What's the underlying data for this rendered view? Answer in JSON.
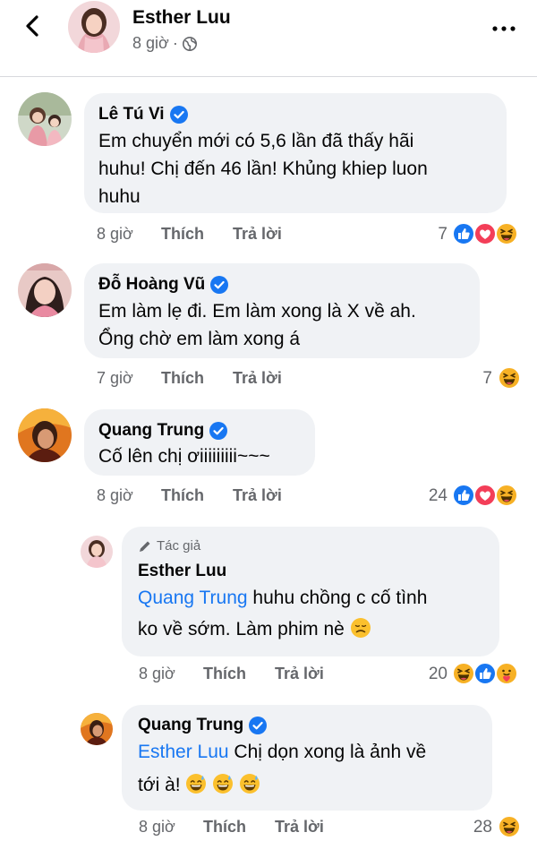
{
  "post": {
    "author": "Esther Luu",
    "time": "8 giờ",
    "privacy_icon": "globe-icon"
  },
  "colors": {
    "bubble": "#f0f2f5",
    "meta_text": "#65676b",
    "link": "#1877f2",
    "verified": "#1877f2",
    "like": "#1877f2",
    "love": "#f33e58",
    "haha": "#f7b125"
  },
  "comments": [
    {
      "name": "Lê Tú Vi",
      "verified": true,
      "lines": [
        "Em chuyển mới có 5,6 lần đã thấy hãi",
        "huhu! Chị đến 46 lần! Khủng khiep luon",
        "huhu"
      ],
      "time": "8 giờ",
      "like_label": "Thích",
      "reply_label": "Trả lời",
      "reaction_count": "7",
      "reactions": [
        "like",
        "love",
        "haha"
      ]
    },
    {
      "name": "Đỗ Hoàng Vũ",
      "verified": true,
      "lines": [
        "Em làm lẹ đi. Em làm xong là X về ah.",
        "Ổng chờ em làm xong á"
      ],
      "time": "7 giờ",
      "like_label": "Thích",
      "reply_label": "Trả lời",
      "reaction_count": "7",
      "reactions": [
        "haha"
      ]
    },
    {
      "name": "Quang Trung",
      "verified": true,
      "lines": [
        "Cố lên chị ơiiiiiiiii~~~"
      ],
      "time": "8 giờ",
      "like_label": "Thích",
      "reply_label": "Trả lời",
      "reaction_count": "24",
      "reactions": [
        "like",
        "love",
        "haha"
      ]
    }
  ],
  "replies": [
    {
      "author_tag": "Tác giả",
      "name": "Esther Luu",
      "verified": false,
      "mention": "Quang Trung",
      "line1_rest": " huhu chồng c cố tình",
      "line2": "ko về sớm. Làm phim nè",
      "emoji": "sad-face-emoji",
      "time": "8 giờ",
      "like_label": "Thích",
      "reply_label": "Trả lời",
      "reaction_count": "20",
      "reactions": [
        "haha",
        "like",
        "care"
      ]
    },
    {
      "name": "Quang Trung",
      "verified": true,
      "mention": "Esther Luu",
      "line1_rest": " Chị dọn xong là ảnh về",
      "line2": "tới à!",
      "emoji": "grinning-sweat-emoji",
      "time": "8 giờ",
      "like_label": "Thích",
      "reply_label": "Trả lời",
      "reaction_count": "28",
      "reactions": [
        "haha"
      ]
    }
  ]
}
